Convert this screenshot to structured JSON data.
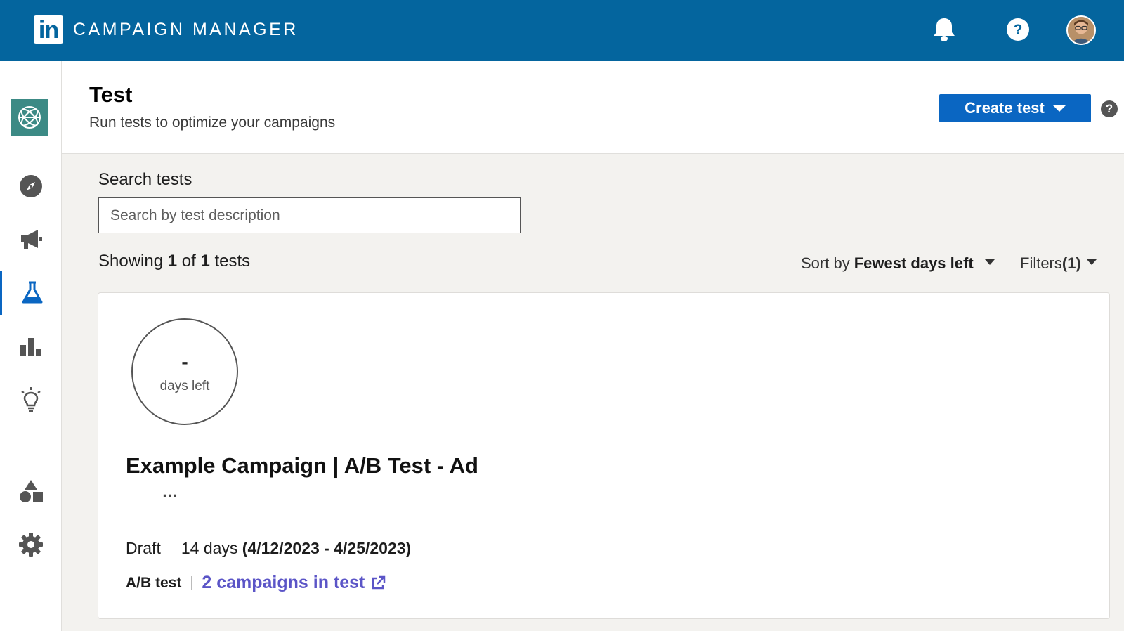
{
  "topbar": {
    "logo_text": "in",
    "app_name": "CAMPAIGN MANAGER",
    "icons": [
      "bell-icon",
      "help-icon",
      "avatar"
    ]
  },
  "sidebar": {
    "items": [
      {
        "name": "account",
        "icon": "account-globe-icon"
      },
      {
        "name": "explore",
        "icon": "compass-icon"
      },
      {
        "name": "campaigns",
        "icon": "megaphone-icon"
      },
      {
        "name": "test",
        "icon": "flask-icon",
        "active": true
      },
      {
        "name": "analytics",
        "icon": "bar-chart-icon"
      },
      {
        "name": "insights",
        "icon": "lightbulb-icon"
      },
      {
        "name": "assets",
        "icon": "shapes-icon"
      },
      {
        "name": "settings",
        "icon": "gear-icon"
      }
    ]
  },
  "header": {
    "title": "Test",
    "subtitle": "Run tests to optimize your campaigns",
    "create_label": "Create test",
    "help_glyph": "?"
  },
  "search": {
    "label": "Search tests",
    "placeholder": "Search by test description",
    "value": ""
  },
  "results": {
    "prefix": "Showing",
    "shown": "1",
    "of": "of",
    "total": "1",
    "suffix": "tests"
  },
  "sort": {
    "prefix": "Sort by",
    "value": "Fewest days left"
  },
  "filters": {
    "label": "Filters",
    "count": "(1)"
  },
  "test_card": {
    "days_value": "-",
    "days_label": "days left",
    "title": "Example Campaign | A/B Test - Ad",
    "more_label": "...",
    "status": "Draft",
    "duration": "14 days",
    "date_range": "(4/12/2023 - 4/25/2023)",
    "type": "A/B test",
    "campaigns_link": "2 campaigns in test"
  },
  "colors": {
    "topbar": "#04659e",
    "primary_button": "#0a66c2",
    "link": "#5b55c7",
    "account_tile": "#3c8a85"
  }
}
